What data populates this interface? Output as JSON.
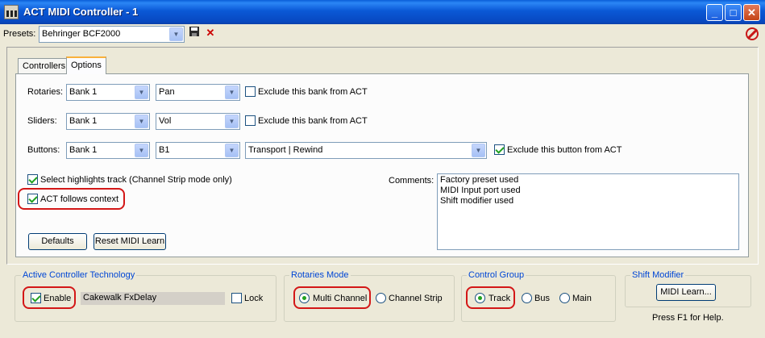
{
  "window": {
    "title": "ACT MIDI Controller - 1",
    "minimize": "_",
    "maximize": "□",
    "close": "✕"
  },
  "presets": {
    "label": "Presets:",
    "value": "Behringer BCF2000",
    "save_icon": "save-icon",
    "delete_icon": "delete-icon",
    "disable_icon": "disable-icon"
  },
  "tabs": [
    {
      "label": "Controllers"
    },
    {
      "label": "Options"
    }
  ],
  "rows": {
    "rotaries": {
      "label": "Rotaries:",
      "bank": "Bank 1",
      "param": "Pan",
      "exclude": "Exclude this bank from ACT",
      "exclude_checked": false
    },
    "sliders": {
      "label": "Sliders:",
      "bank": "Bank 1",
      "param": "Vol",
      "exclude": "Exclude this bank from ACT",
      "exclude_checked": false
    },
    "buttons": {
      "label": "Buttons:",
      "bank": "Bank 1",
      "param": "B1",
      "action": "Transport | Rewind",
      "exclude": "Exclude this button from ACT",
      "exclude_checked": true
    }
  },
  "options": {
    "select_highlights": "Select highlights track (Channel Strip mode only)",
    "act_follows": "ACT follows context"
  },
  "comments": {
    "label": "Comments:",
    "lines": [
      "Factory preset used",
      "MIDI Input port used",
      "Shift modifier used"
    ]
  },
  "buttons": {
    "defaults": "Defaults",
    "reset": "Reset MIDI Learn"
  },
  "act_group": {
    "title": "Active Controller Technology",
    "enable": "Enable",
    "plugin": "Cakewalk FxDelay",
    "lock": "Lock"
  },
  "rotaries_mode": {
    "title": "Rotaries Mode",
    "multi": "Multi Channel",
    "strip": "Channel Strip"
  },
  "control_group": {
    "title": "Control Group",
    "track": "Track",
    "bus": "Bus",
    "main": "Main"
  },
  "shift": {
    "title": "Shift Modifier",
    "learn": "MIDI Learn..."
  },
  "help": "Press F1 for Help."
}
